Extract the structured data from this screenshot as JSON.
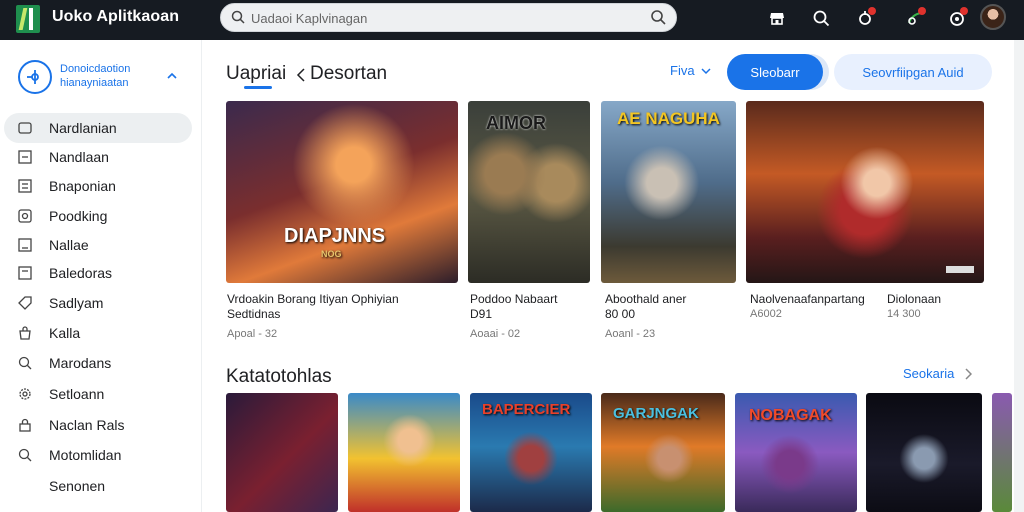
{
  "app": {
    "title": "Uoko Aplitkaoan"
  },
  "search": {
    "placeholder": "Uadaoi Kaplvinagan"
  },
  "topbar": {
    "icons": [
      "store-icon",
      "search-icon",
      "notification-icon",
      "chat-icon",
      "alert-icon"
    ]
  },
  "sidebar": {
    "header": "Donoicdaotion hianayniaatan",
    "items": [
      {
        "label": "Nardlanian",
        "icon": "games-icon",
        "active": true
      },
      {
        "label": "Nandlaan",
        "icon": "list-icon",
        "active": false
      },
      {
        "label": "Bnaponian",
        "icon": "apps-icon",
        "active": false
      },
      {
        "label": "Poodking",
        "icon": "movies-icon",
        "active": false
      },
      {
        "label": "Nallae",
        "icon": "book-icon",
        "active": false
      },
      {
        "label": "Baledoras",
        "icon": "grid-icon",
        "active": false
      },
      {
        "label": "Sadlyam",
        "icon": "tag-icon",
        "active": false
      },
      {
        "label": "Kalla",
        "icon": "bag-icon",
        "active": false
      },
      {
        "label": "Marodans",
        "icon": "magnify-icon",
        "active": false
      },
      {
        "label": "Setloann",
        "icon": "gear-icon",
        "active": false
      },
      {
        "label": "Naclan Rals",
        "icon": "lock-icon",
        "active": false
      },
      {
        "label": "Motomlidan",
        "icon": "search-icon",
        "active": false
      },
      {
        "label": "Senonen",
        "icon": "",
        "active": false
      }
    ]
  },
  "main": {
    "section1": {
      "title": "Uapriai",
      "tab": "Desortan"
    },
    "filter_label": "Fiva",
    "primary_button": "Sleobarr",
    "secondary_button": "Seovrfiipgan Auid",
    "featured": [
      {
        "title": "Vrdoakin Borang Itiyan Ophiyian",
        "subtitle": "Sedtidnas",
        "meta": "Apoal - 32",
        "cover": "DIAPJNNS",
        "cover_sub": "NOG"
      },
      {
        "title": "Poddoo Nabaart",
        "subtitle": "D91",
        "meta": "Aoaai - 02",
        "cover": "AIMOR",
        "cover_sub": ""
      },
      {
        "title": "Aboothald aner",
        "subtitle": "80 00",
        "meta": "Aoanl - 23",
        "cover": "AE NAGUHA",
        "cover_sub": ""
      },
      {
        "title": "Naolvenaafanpartang",
        "subtitle": "",
        "meta": "A6002",
        "cover": "",
        "cover_sub": ""
      },
      {
        "title": "Diolonaan",
        "subtitle": "",
        "meta": "14 300",
        "cover": "",
        "cover_sub": ""
      }
    ],
    "section2": {
      "title": "Katatotohlas",
      "see_all": "Seokaria"
    },
    "thumbs": [
      {
        "cover": ""
      },
      {
        "cover": ""
      },
      {
        "cover": "BAPERCIER"
      },
      {
        "cover": "GARJNGAK"
      },
      {
        "cover": "NOBAGAK"
      },
      {
        "cover": ""
      },
      {
        "cover": ""
      }
    ]
  },
  "colors": {
    "accent": "#1a73e8",
    "topbar": "#161b22",
    "active_nav": "#eceff1"
  }
}
